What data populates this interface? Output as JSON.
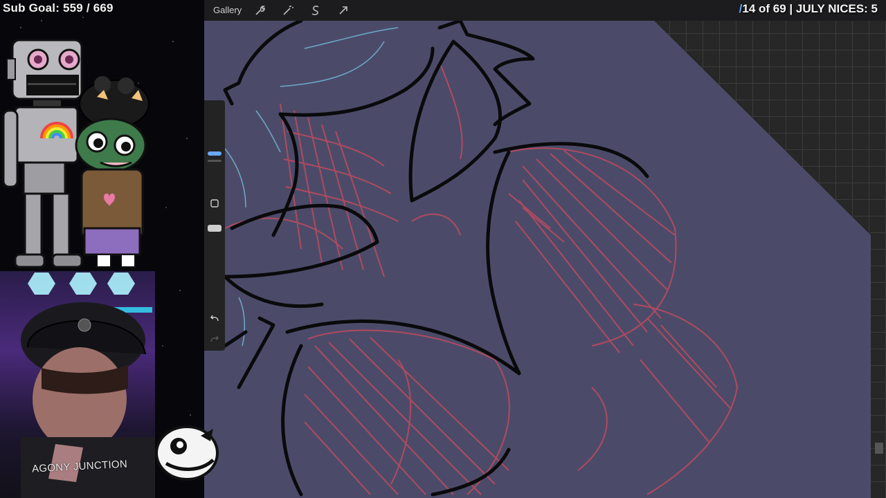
{
  "overlay": {
    "sub_goal": "Sub Goal: 559 / 669",
    "counter_prefix": "14 of 69 | JULY NICES: 5",
    "shirt_text": "AGONY JUNCTION"
  },
  "toolbar": {
    "gallery_label": "Gallery",
    "icons": [
      "wrench-icon",
      "magic-wand-icon",
      "selection-s-icon",
      "arrow-cursor-icon"
    ]
  },
  "sidebar": {
    "buttons": [
      "brush-size-slider",
      "modify-button",
      "opacity-slider",
      "undo-icon",
      "redo-icon"
    ]
  },
  "colors": {
    "canvas": "#4b4b69",
    "line_art": "#0a0a0c",
    "sketch_red": "#c24a5e",
    "sketch_blue": "#6fa9c9",
    "accent_blue": "#6aa7ff"
  }
}
